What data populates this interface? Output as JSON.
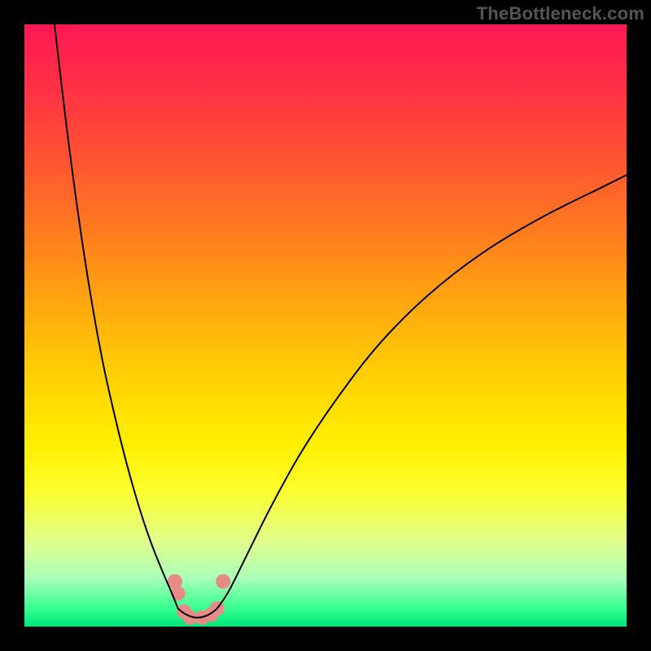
{
  "attribution": "TheBottleneck.com",
  "chart_data": {
    "type": "line",
    "title": "",
    "xlabel": "",
    "ylabel": "",
    "xlim": [
      0,
      100
    ],
    "ylim": [
      0,
      100
    ],
    "series": [
      {
        "name": "left-branch",
        "x": [
          5,
          7,
          9,
          11,
          13,
          15,
          17,
          19,
          21,
          23,
          24.5,
          25.5
        ],
        "values": [
          100,
          83,
          68,
          55,
          44,
          35,
          27,
          20,
          14,
          9,
          5.5,
          3
        ]
      },
      {
        "name": "right-branch",
        "x": [
          32,
          34,
          37,
          41,
          46,
          52,
          59,
          67,
          76,
          86,
          96,
          100
        ],
        "values": [
          3,
          6,
          12,
          20,
          29,
          38,
          47,
          55,
          62,
          68,
          73,
          75
        ]
      }
    ],
    "flat_region": {
      "x_start": 25.5,
      "x_end": 32,
      "value": 0
    },
    "markers": [
      {
        "x": 25.0,
        "y": 7.5
      },
      {
        "x": 25.5,
        "y": 5.5
      },
      {
        "x": 26.5,
        "y": 2.5
      },
      {
        "x": 27.5,
        "y": 1.5
      },
      {
        "x": 29.5,
        "y": 1.5
      },
      {
        "x": 31.0,
        "y": 2.0
      },
      {
        "x": 32.0,
        "y": 3.0
      },
      {
        "x": 33.0,
        "y": 7.5
      }
    ],
    "marker_color": "#e78b86",
    "curve_color": "#000000"
  }
}
